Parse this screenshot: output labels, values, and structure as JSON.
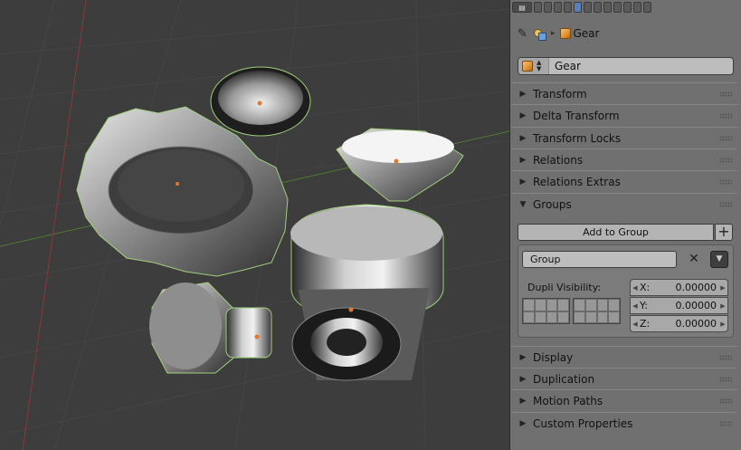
{
  "header": {
    "context_tabs": [
      "render-icon",
      "render-layers-icon",
      "scene-icon",
      "world-icon",
      "object-icon",
      "constraints-icon",
      "modifiers-icon",
      "data-icon",
      "material-icon",
      "texture-icon",
      "particles-icon",
      "physics-icon"
    ]
  },
  "breadcrumb": {
    "object_name": "Gear"
  },
  "object": {
    "name": "Gear"
  },
  "panels": {
    "transform": "Transform",
    "delta_transform": "Delta Transform",
    "transform_locks": "Transform Locks",
    "relations": "Relations",
    "relations_extras": "Relations Extras",
    "groups": "Groups",
    "display": "Display",
    "duplication": "Duplication",
    "motion_paths": "Motion Paths",
    "custom_properties": "Custom Properties"
  },
  "groups": {
    "add_label": "Add to Group",
    "group_name": "Group",
    "dupli_visibility_label": "Dupli Visibility:",
    "offset": {
      "x_label": "X:",
      "x_value": "0.00000",
      "y_label": "Y:",
      "y_value": "0.00000",
      "z_label": "Z:",
      "z_value": "0.00000"
    }
  },
  "colors": {
    "accent": "#5680c2",
    "panel": "#707070",
    "viewport": "#3d3d3d",
    "object_icon": "#e29231"
  }
}
